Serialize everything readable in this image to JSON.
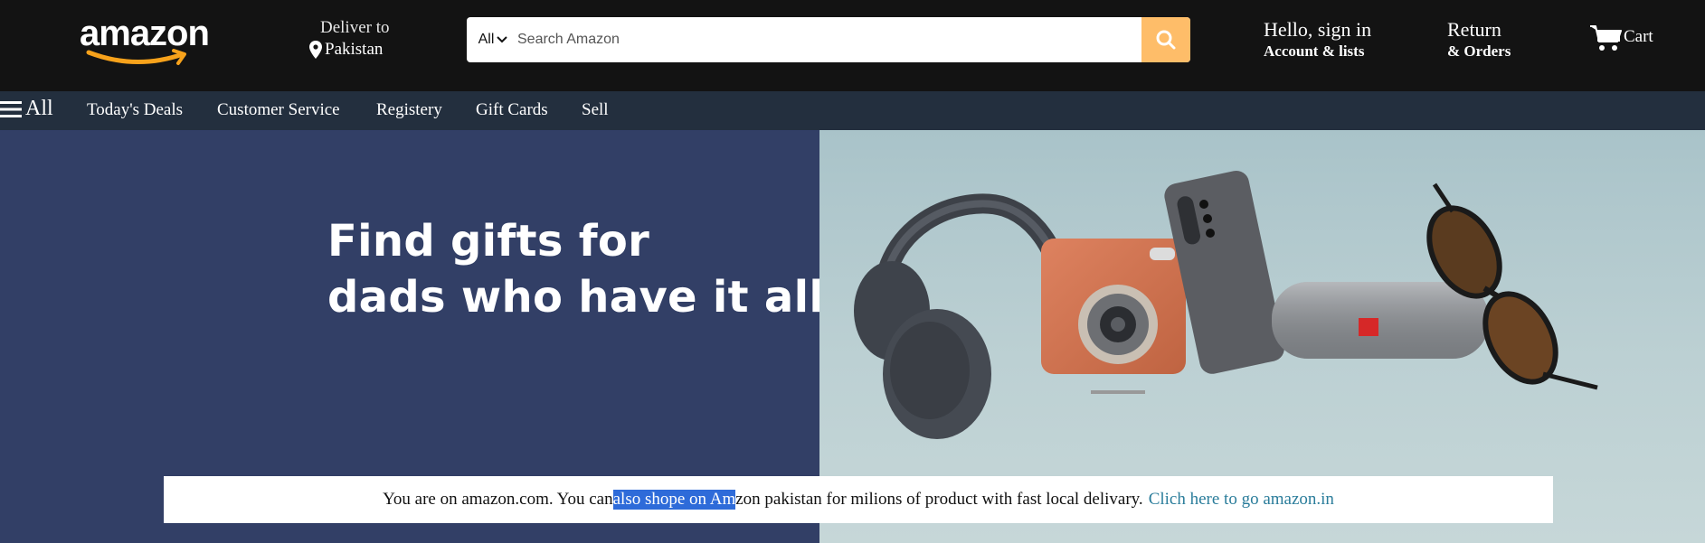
{
  "header": {
    "logo_text": "amazon",
    "deliver": {
      "line1": "Deliver to",
      "location": "Pakistan"
    },
    "search": {
      "category": "All",
      "placeholder": "Search Amazon"
    },
    "signin": {
      "line1": "Hello, sign in",
      "line2": "Account & lists"
    },
    "returns": {
      "line1": "Return",
      "line2": "& Orders"
    },
    "cart_label": "Cart"
  },
  "nav": {
    "all_label": "All",
    "items": [
      "Today's Deals",
      "Customer Service",
      "Registery",
      "Gift Cards",
      "Sell"
    ]
  },
  "hero": {
    "title_line1": "Find gifts for",
    "title_line2": "dads who have it all",
    "product_icons": [
      "headphones-icon",
      "instant-camera-icon",
      "smartphone-icon",
      "speaker-icon",
      "sunglasses-icon"
    ]
  },
  "notice": {
    "text_before": "You are on amazon.com. You can",
    "text_selected": " also shope on Am",
    "text_after": "zon pakistan for milions of product with fast local delivary.",
    "link_text": "Clich here to go amazon.in"
  },
  "colors": {
    "header_bg": "#131313",
    "nav_bg": "#232f3e",
    "search_button": "#febd69",
    "hero_left_bg": "#323f66",
    "link": "#2b7d9b",
    "selection": "#2e6bd9",
    "logo_smile": "#f7a21b"
  }
}
